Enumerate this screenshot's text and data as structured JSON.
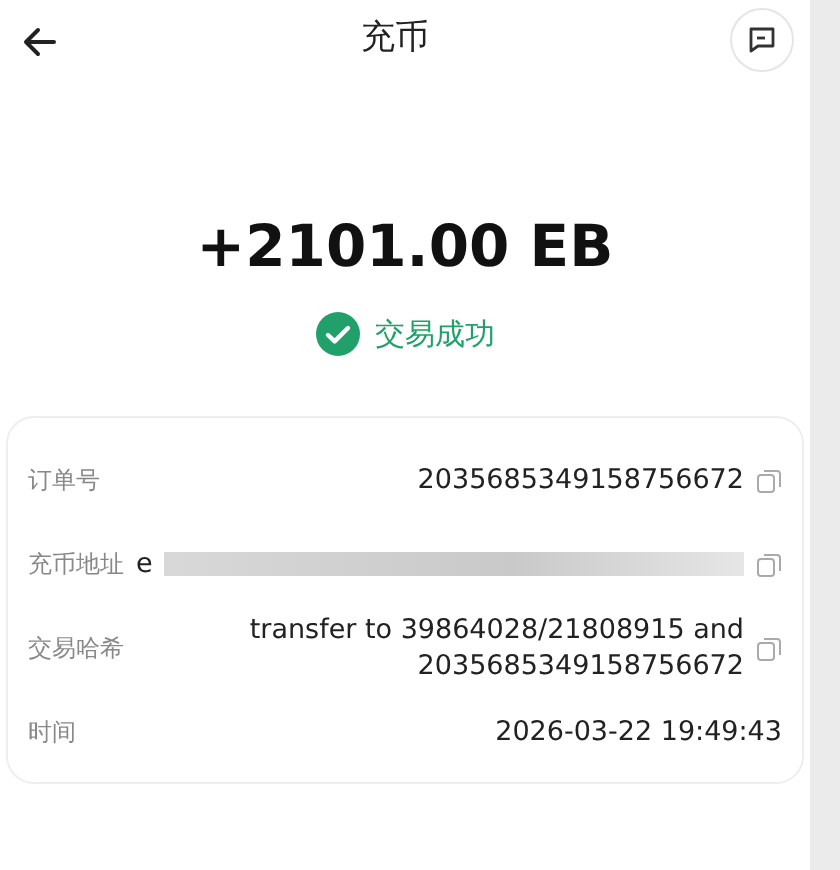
{
  "header": {
    "title": "充币"
  },
  "amount": "+2101.00 EB",
  "status": {
    "label": "交易成功",
    "success": true
  },
  "details": [
    {
      "label": "订单号",
      "value": "2035685349158756672",
      "kind": "copy"
    },
    {
      "label": "充币地址",
      "value": "e",
      "kind": "redacted"
    },
    {
      "label": "交易哈希",
      "value": "transfer to 39864028/21808915 and 2035685349158756672",
      "kind": "copy"
    },
    {
      "label": "时间",
      "value": "2026-03-22 19:49:43",
      "kind": "plain"
    }
  ]
}
